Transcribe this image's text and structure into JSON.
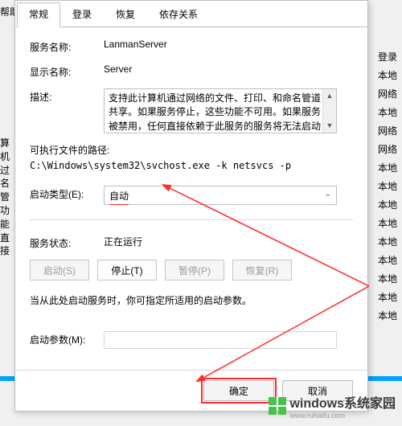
{
  "left_header": "帮助(H)",
  "left_sidebar": [
    "算机过",
    "名管",
    "功能",
    "直接"
  ],
  "right_labels": [
    "登录",
    "本地",
    "网络",
    "本地",
    "网络",
    "网络",
    "本地",
    "本地",
    "本地",
    "本地",
    "本地",
    "本地",
    "本地",
    "本地",
    "本地"
  ],
  "tabs": {
    "t0": "常规",
    "t1": "登录",
    "t2": "恢复",
    "t3": "依存关系"
  },
  "labels": {
    "service_name": "服务名称:",
    "display_name": "显示名称:",
    "description": "描述:",
    "exec_path_note": "可执行文件的路径:",
    "startup_type": "启动类型(E):",
    "service_status": "服务状态:",
    "params_note": "当从此处启动服务时，你可指定所适用的启动参数。",
    "startup_params": "启动参数(M):"
  },
  "values": {
    "service_name": "LanmanServer",
    "display_name": "Server",
    "description": "支持此计算机通过网络的文件、打印、和命名管道共享。如果服务停止，这些功能不可用。如果服务被禁用，任何直接依赖于此服务的服务将无法启动",
    "exec_path": "C:\\Windows\\system32\\svchost.exe -k netsvcs -p",
    "startup_type": "自动",
    "service_status": "正在运行",
    "startup_params": ""
  },
  "buttons": {
    "start": "启动(S)",
    "stop": "停止(T)",
    "pause": "暂停(P)",
    "resume": "恢复(R)",
    "ok": "确定",
    "cancel": "取消"
  },
  "watermark": {
    "title": "windows系统家园",
    "sub": "www.ruhaifu.com"
  }
}
